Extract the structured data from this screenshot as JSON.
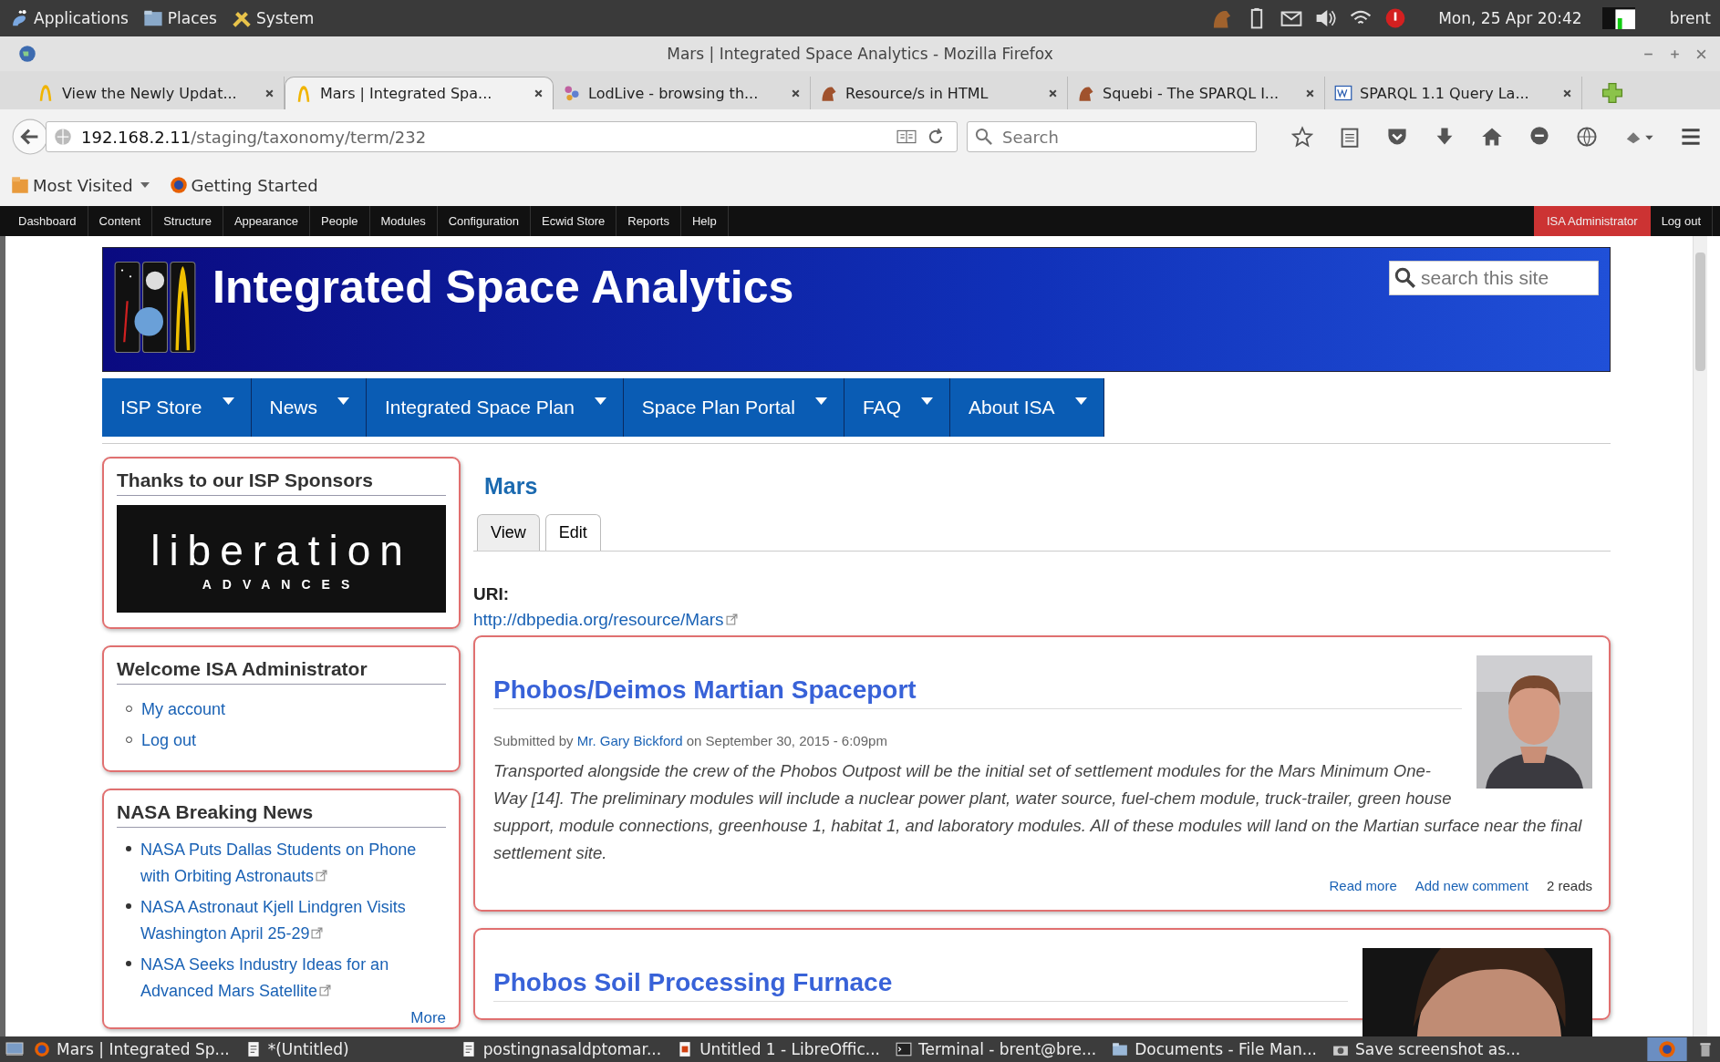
{
  "top_panel": {
    "menus": [
      "Applications",
      "Places",
      "System"
    ],
    "clock": "Mon, 25 Apr 20:42",
    "user": "brent"
  },
  "window": {
    "title": "Mars | Integrated Space Analytics - Mozilla Firefox"
  },
  "tabs": [
    {
      "label": "View the Newly Updat...",
      "selected": false
    },
    {
      "label": "Mars | Integrated Spa...",
      "selected": true
    },
    {
      "label": "LodLive - browsing th...",
      "selected": false
    },
    {
      "label": "Resource/s in HTML",
      "selected": false
    },
    {
      "label": "Squebi - The SPARQL I...",
      "selected": false
    },
    {
      "label": "SPARQL 1.1 Query La...",
      "selected": false
    }
  ],
  "address_bar": {
    "host": "192.168.2.11",
    "path": "/staging/taxonomy/term/232"
  },
  "search": {
    "placeholder": "Search"
  },
  "bookmarks": [
    "Most Visited",
    "Getting Started"
  ],
  "admin_menu": {
    "items": [
      "Dashboard",
      "Content",
      "Structure",
      "Appearance",
      "People",
      "Modules",
      "Configuration",
      "Ecwid Store",
      "Reports",
      "Help"
    ],
    "user": "ISA Administrator",
    "logout": "Log out"
  },
  "site": {
    "name": "Integrated Space Analytics",
    "search_placeholder": "search this site"
  },
  "main_menu": [
    "ISP Store",
    "News",
    "Integrated Space Plan",
    "Space Plan Portal",
    "FAQ",
    "About ISA"
  ],
  "sidebar": {
    "sponsors": {
      "title": "Thanks to our ISP Sponsors",
      "logo_word": "liberation",
      "logo_sub": "ADVANCES"
    },
    "user_block": {
      "title": "Welcome ISA Administrator",
      "links": [
        "My account",
        "Log out"
      ]
    },
    "news": {
      "title": "NASA Breaking News",
      "items": [
        "NASA Puts Dallas Students on Phone with Orbiting Astronauts",
        "NASA Astronaut Kjell Lindgren Visits Washington April 25-29",
        "NASA Seeks Industry Ideas for an Advanced Mars Satellite"
      ],
      "more": "More"
    }
  },
  "term": {
    "title": "Mars",
    "local_tabs": [
      {
        "label": "View",
        "selected": true
      },
      {
        "label": "Edit",
        "selected": false
      }
    ],
    "uri_label": "URI:",
    "uri": "http://dbpedia.org/resource/Mars"
  },
  "articles": [
    {
      "title": "Phobos/Deimos Martian Spaceport",
      "submitted_prefix": "Submitted by",
      "author": "Mr. Gary Bickford",
      "submitted_suffix": "on September 30, 2015 - 6:09pm",
      "body": "Transported alongside the crew of the Phobos Outpost will be the initial set of settlement modules for the Mars Minimum One-Way [14]. The preliminary modules will include a nuclear power plant, water source, fuel-chem module, truck-trailer, green house support, module connections, greenhouse 1, habitat 1, and laboratory modules. All of these modules will land on the Martian surface near the final settlement site.",
      "links": [
        "Read more",
        "Add new comment"
      ],
      "reads": "2 reads"
    },
    {
      "title": "Phobos Soil Processing Furnace"
    }
  ],
  "taskbar": [
    "Mars | Integrated Sp...",
    "*(Untitled)",
    "postingnasaldptomar...",
    "Untitled 1 - LibreOffic...",
    "Terminal - brent@bre...",
    "Documents - File Man...",
    "Save screenshot as..."
  ]
}
